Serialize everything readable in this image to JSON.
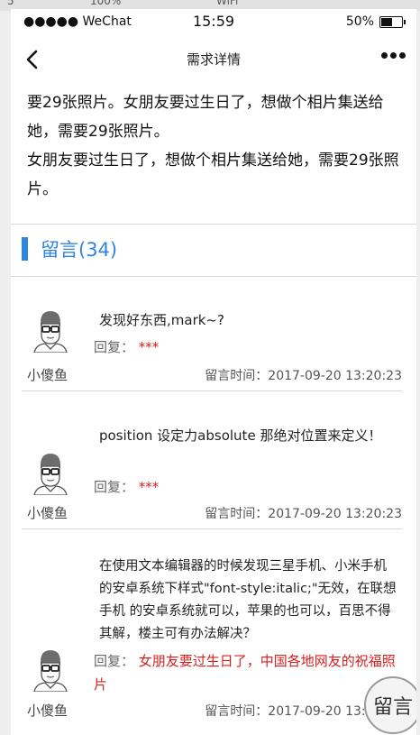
{
  "outer_strip": [
    "5",
    "100%",
    "WiFi"
  ],
  "status_bar": {
    "signal": "●●●●● WeChat",
    "time": "15:59",
    "battery_text": "50%",
    "battery_level": 0.5
  },
  "nav": {
    "title": "需求详情",
    "back_icon": "chevron-left-icon",
    "more_icon": "more-dots-icon"
  },
  "description": {
    "paragraphs": [
      "要29张照片。女朋友要过生日了，想做个相片集送给她，需要29张照片。",
      "女朋友要过生日了，想做个相片集送给她，需要29张照片。"
    ]
  },
  "comments_section": {
    "title": "留言(34)",
    "accent_color": "#2e86de"
  },
  "comments": [
    {
      "text": "发现好东西,mark~?",
      "reply_label": "回复：",
      "reply": "***",
      "user": "小傻鱼",
      "time": "留言时间：2017-09-20 13:20:23"
    },
    {
      "text": "position 设定力absolute 那绝对位置来定义！",
      "reply_label": "回复：",
      "reply": "***",
      "user": "小傻鱼",
      "time": "留言时间：2017-09-20 13:20:23"
    },
    {
      "text": "在使用文本编辑器的时候发现三星手机、小米手机的安卓系统下样式\"font-style:italic;\"无效，在联想手机 的安卓系统就可以，苹果的也可以，百思不得其解，楼主可有办法解决？",
      "reply_label": "回复：",
      "reply": "女朋友要过生日了，中国各地网友的祝福照片",
      "user": "小傻鱼",
      "time": "留言时间：2017-09-20 13:20:23"
    }
  ],
  "fab": {
    "label": "留言"
  }
}
